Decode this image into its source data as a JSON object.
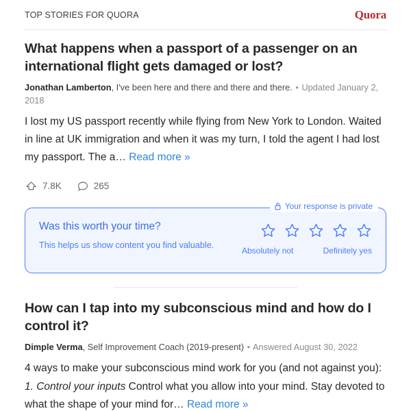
{
  "header": {
    "title": "TOP STORIES FOR QUORA",
    "brand": "Quora",
    "brand_color": "#b92b27"
  },
  "stories": [
    {
      "title": "What happens when a passport of a passenger on an international flight gets damaged or lost?",
      "author": "Jonathan Lamberton",
      "credential": ", I've been here and there and there and there.",
      "separator": "•",
      "timestamp": "Updated January 2, 2018",
      "answer_text": "I lost my US passport recently while flying from New York to London. Waited in line at UK immigration and when it was my turn, I told the agent I had lost my passport. The a… ",
      "read_more": "Read more »",
      "upvotes": "7.8K",
      "comments": "265"
    },
    {
      "title": "How can I tap into my subconscious mind and how do I control it?",
      "author": "Dimple Verma",
      "credential": ", Self Improvement Coach (2019-present)",
      "separator": "•",
      "timestamp": "Answered August 30, 2022",
      "answer_lead": "4 ways to make your subconscious mind work for you (and not against you): ",
      "answer_italic": "1. Control your inputs",
      "answer_tail": " Control what you allow into your mind. Stay devoted to what the shape of your mind for… ",
      "read_more": "Read more »"
    }
  ],
  "feedback": {
    "heading": "Was this worth your time?",
    "subtext": "This helps us show content you find valuable.",
    "privacy_label": "Your response is private",
    "low_label": "Absolutely not",
    "high_label": "Definitely yes",
    "star_count": 5,
    "accent_color": "#4a7dfd",
    "background_color": "#f1f5ff"
  }
}
